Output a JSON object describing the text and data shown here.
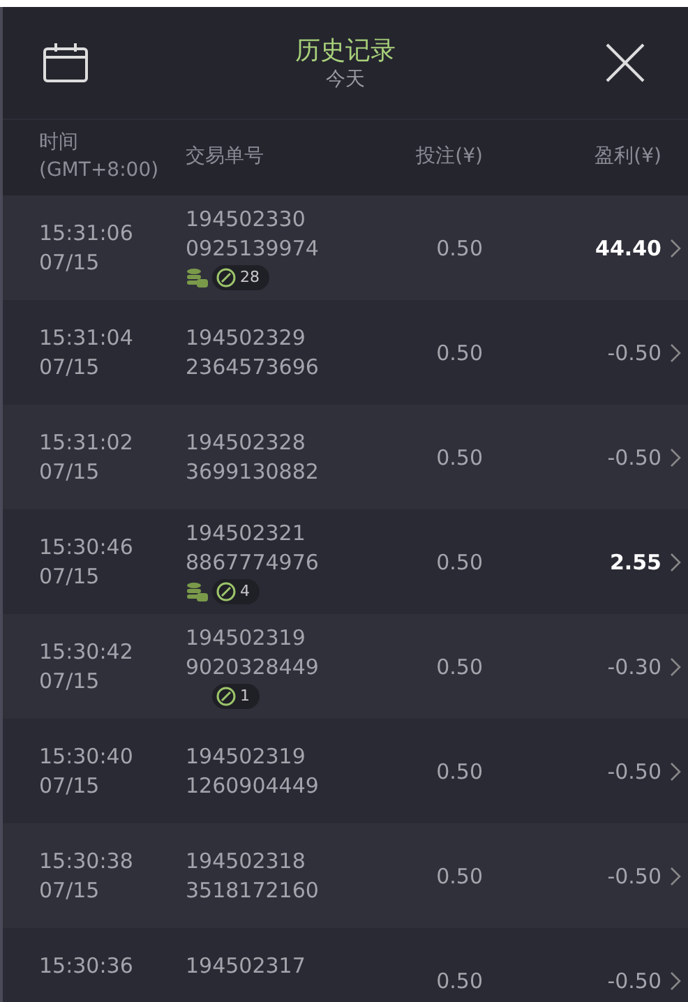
{
  "header": {
    "title": "历史记录",
    "subtitle": "今天"
  },
  "columns": [
    "时间\n(GMT+8:00)",
    "交易单号",
    "投注(¥)",
    "盈利(¥)"
  ],
  "rows": [
    {
      "time": "15:31:06",
      "date": "07/15",
      "id_1": "194502330",
      "id_2": "0925139974",
      "stake": "0.50",
      "profit": "44.40",
      "win": true,
      "coins": true,
      "count": "28"
    },
    {
      "time": "15:31:04",
      "date": "07/15",
      "id_1": "194502329",
      "id_2": "2364573696",
      "stake": "0.50",
      "profit": "-0.50",
      "win": false,
      "coins": false
    },
    {
      "time": "15:31:02",
      "date": "07/15",
      "id_1": "194502328",
      "id_2": "3699130882",
      "stake": "0.50",
      "profit": "-0.50",
      "win": false,
      "coins": false
    },
    {
      "time": "15:30:46",
      "date": "07/15",
      "id_1": "194502321",
      "id_2": "8867774976",
      "stake": "0.50",
      "profit": "2.55",
      "win": true,
      "coins": true,
      "count": "4"
    },
    {
      "time": "15:30:42",
      "date": "07/15",
      "id_1": "194502319",
      "id_2": "9020328449",
      "stake": "0.50",
      "profit": "-0.30",
      "win": false,
      "coins": false,
      "count": "1"
    },
    {
      "time": "15:30:40",
      "date": "07/15",
      "id_1": "194502319",
      "id_2": "1260904449",
      "stake": "0.50",
      "profit": "-0.50",
      "win": false,
      "coins": false
    },
    {
      "time": "15:30:38",
      "date": "07/15",
      "id_1": "194502318",
      "id_2": "3518172160",
      "stake": "0.50",
      "profit": "-0.50",
      "win": false,
      "coins": false
    },
    {
      "time": "15:30:36",
      "id_1": "194502317",
      "stake": "0.50",
      "profit": "-0.50",
      "win": false,
      "coins": false
    }
  ]
}
